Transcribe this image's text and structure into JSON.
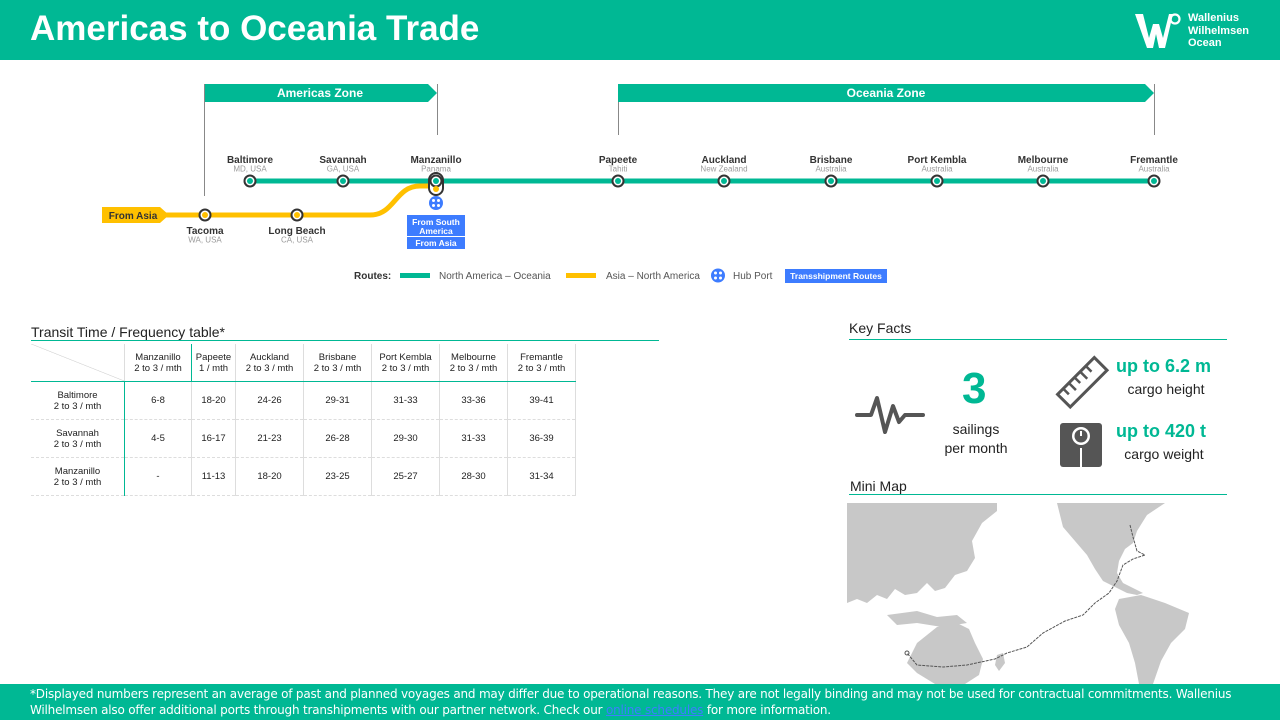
{
  "header": {
    "title": "Americas to Oceania Trade",
    "logo_lines": [
      "Wallenius",
      "Wilhelmsen",
      "Ocean"
    ]
  },
  "zones": {
    "americas": "Americas Zone",
    "oceania": "Oceania Zone"
  },
  "from_asia_label": "From Asia",
  "green_stations": [
    {
      "name": "Baltimore",
      "sub": "MD, USA"
    },
    {
      "name": "Savannah",
      "sub": "GA, USA"
    },
    {
      "name": "Manzanillo",
      "sub": "Panama"
    },
    {
      "name": "Papeete",
      "sub": "Tahiti"
    },
    {
      "name": "Auckland",
      "sub": "New Zealand"
    },
    {
      "name": "Brisbane",
      "sub": "Australia"
    },
    {
      "name": "Port Kembla",
      "sub": "Australia"
    },
    {
      "name": "Melbourne",
      "sub": "Australia"
    },
    {
      "name": "Fremantle",
      "sub": "Australia"
    }
  ],
  "yellow_stations": [
    {
      "name": "Tacoma",
      "sub": "WA, USA"
    },
    {
      "name": "Long Beach",
      "sub": "CA, USA"
    }
  ],
  "transship": {
    "line1": "From South",
    "line2": "America",
    "line3": "From Asia"
  },
  "legend": {
    "routes_label": "Routes:",
    "north_america_oceania": "North America – Oceania",
    "asia_north_america": "Asia – North America",
    "hub_port": "Hub Port",
    "transshipment": "Transshipment Routes"
  },
  "colors": {
    "brand": "#00b894",
    "route_green": "#00b894",
    "route_yellow": "#ffc000",
    "transship_blue": "#3d7cff"
  },
  "transit_table": {
    "title": "Transit Time / Frequency table*",
    "columns": [
      {
        "port": "Manzanillo",
        "freq": "2 to 3 / mth"
      },
      {
        "port": "Papeete",
        "freq": "1 / mth"
      },
      {
        "port": "Auckland",
        "freq": "2 to 3 / mth"
      },
      {
        "port": "Brisbane",
        "freq": "2 to 3 / mth"
      },
      {
        "port": "Port Kembla",
        "freq": "2 to 3 / mth"
      },
      {
        "port": "Melbourne",
        "freq": "2 to 3 / mth"
      },
      {
        "port": "Fremantle",
        "freq": "2 to 3 / mth"
      }
    ],
    "rows": [
      {
        "port": "Baltimore",
        "freq": "2 to 3 / mth",
        "values": [
          "6-8",
          "18-20",
          "24-26",
          "29-31",
          "31-33",
          "33-36",
          "39-41"
        ]
      },
      {
        "port": "Savannah",
        "freq": "2 to 3 / mth",
        "values": [
          "4-5",
          "16-17",
          "21-23",
          "26-28",
          "29-30",
          "31-33",
          "36-39"
        ]
      },
      {
        "port": "Manzanillo",
        "freq": "2 to 3 / mth",
        "values": [
          "-",
          "11-13",
          "18-20",
          "23-25",
          "25-27",
          "28-30",
          "31-34"
        ]
      }
    ]
  },
  "key_facts": {
    "title": "Key Facts",
    "sailings_count": "3",
    "sailings_label_1": "sailings",
    "sailings_label_2": "per month",
    "height_value": "up to 6.2 m",
    "height_label": "cargo height",
    "weight_value": "up to 420 t",
    "weight_label": "cargo weight"
  },
  "mini_map": {
    "title": "Mini Map"
  },
  "footer": {
    "text_before": "*Displayed numbers represent  an average of past and planned voyages and may differ due to operational reasons. They are not legally binding and may not be used for contractual commitments. Wallenius Wilhelmsen also offer additional ports through transhipments with our partner network.  Check our ",
    "link": "online schedules",
    "text_after": " for more information."
  }
}
